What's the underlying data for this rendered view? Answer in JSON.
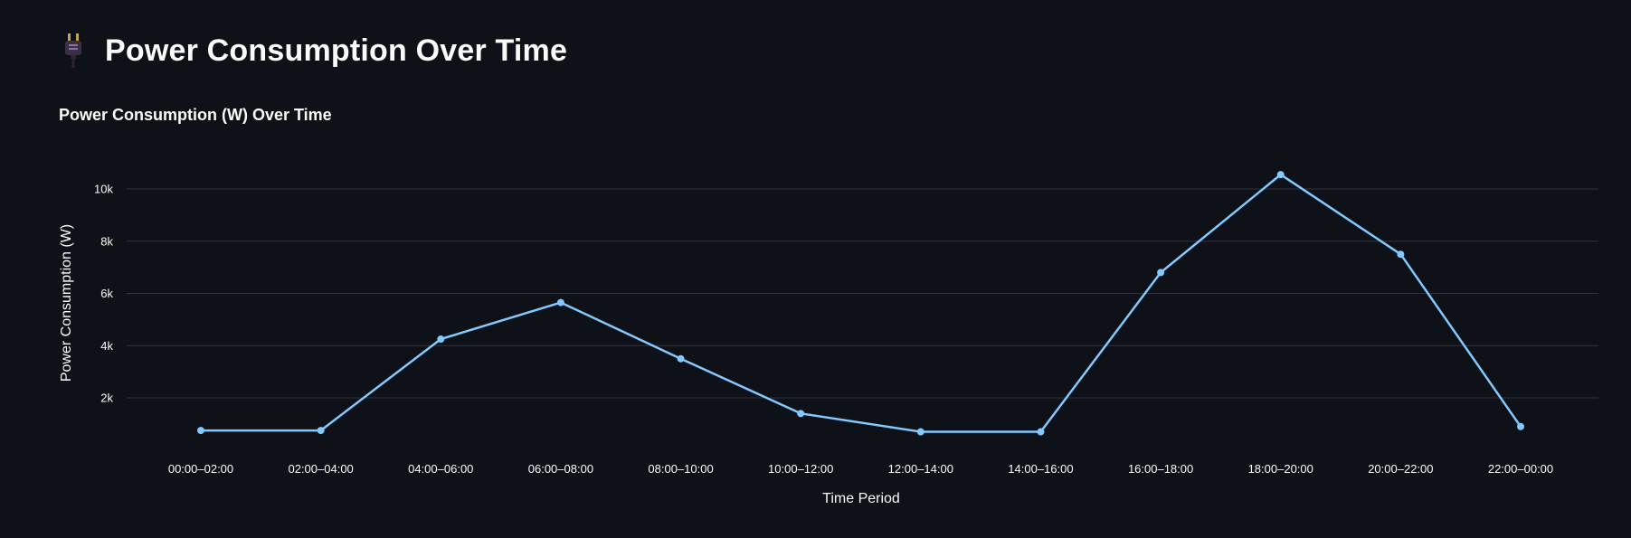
{
  "page": {
    "icon": "electric-plug-icon",
    "title": "Power Consumption Over Time"
  },
  "colors": {
    "background": "#0e1117",
    "line": "#83c9ff",
    "grid": "#31333f",
    "text": "#fafafa"
  },
  "chart_data": {
    "type": "line",
    "title": "Power Consumption (W) Over Time",
    "xlabel": "Time Period",
    "ylabel": "Power Consumption (W)",
    "categories": [
      "00:00–02:00",
      "02:00–04:00",
      "04:00–06:00",
      "06:00–08:00",
      "08:00–10:00",
      "10:00–12:00",
      "12:00–14:00",
      "14:00–16:00",
      "16:00–18:00",
      "18:00–20:00",
      "20:00–22:00",
      "22:00–00:00"
    ],
    "series": [
      {
        "values": [
          750,
          750,
          4250,
          5650,
          3500,
          1400,
          700,
          700,
          6800,
          10550,
          7500,
          900
        ]
      }
    ],
    "yticks": [
      2000,
      4000,
      6000,
      8000,
      10000
    ],
    "ytick_labels": [
      "2k",
      "4k",
      "6k",
      "8k",
      "10k"
    ],
    "ylim": [
      0,
      11000
    ],
    "grid": true,
    "legend": false
  }
}
